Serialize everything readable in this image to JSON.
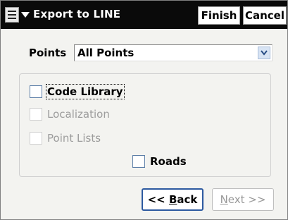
{
  "titlebar": {
    "title": "Export to LINE",
    "finish_label": "Finish",
    "cancel_label": "Cancel",
    "menu_icon": "menu-icon"
  },
  "points": {
    "label": "Points",
    "selected": "All Points"
  },
  "options": {
    "code_library": {
      "label": "Code Library",
      "checked": false,
      "enabled": true
    },
    "localization": {
      "label": "Localization",
      "checked": false,
      "enabled": false
    },
    "point_lists": {
      "label": "Point Lists",
      "checked": false,
      "enabled": false
    },
    "roads": {
      "label": "Roads",
      "checked": false,
      "enabled": true
    }
  },
  "nav": {
    "back_prefix": "<< ",
    "back_accel": "B",
    "back_rest": "ack",
    "next_accel": "N",
    "next_rest": "ext >>"
  },
  "colors": {
    "titlebar_bg": "#0a0a0a",
    "focus_border": "#2d5aa0",
    "disabled_text": "#9c9c9c"
  }
}
